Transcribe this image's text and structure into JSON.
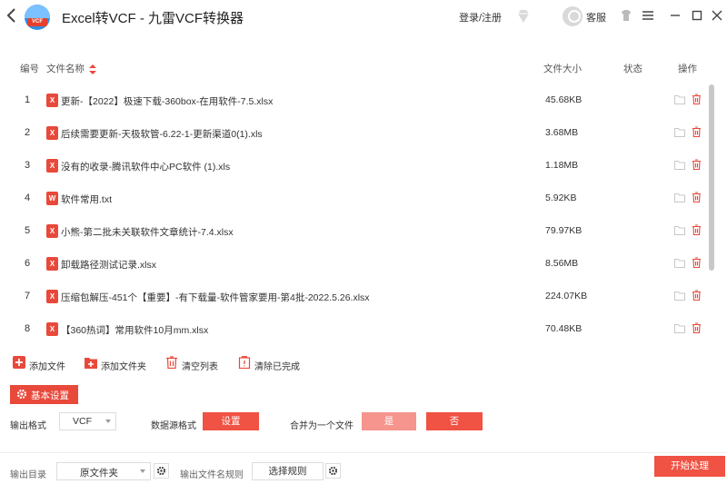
{
  "titlebar": {
    "title": "Excel转VCF - 九雷VCF转换器",
    "logo_tag": "VCF",
    "login": "登录/注册",
    "service": "客服"
  },
  "table": {
    "headers": {
      "index": "编号",
      "name": "文件名称",
      "size": "文件大小",
      "status": "状态",
      "action": "操作"
    },
    "rows": [
      {
        "index": "1",
        "type": "X",
        "name": "更新-【2022】极速下载-360box-在用软件-7.5.xlsx",
        "size": "45.68KB"
      },
      {
        "index": "2",
        "type": "X",
        "name": "后续需要更新-天极软管-6.22-1-更新渠道0(1).xls",
        "size": "3.68MB"
      },
      {
        "index": "3",
        "type": "X",
        "name": "没有的收录-腾讯软件中心PC软件 (1).xls",
        "size": "1.18MB"
      },
      {
        "index": "4",
        "type": "W",
        "name": "软件常用.txt",
        "size": "5.92KB"
      },
      {
        "index": "5",
        "type": "X",
        "name": "小熊-第二批未关联软件文章统计-7.4.xlsx",
        "size": "79.97KB"
      },
      {
        "index": "6",
        "type": "X",
        "name": "卸载路径测试记录.xlsx",
        "size": "8.56MB"
      },
      {
        "index": "7",
        "type": "X",
        "name": "压缩包解压-451个【重要】-有下载量-软件管家要用-第4批-2022.5.26.xlsx",
        "size": "224.07KB"
      },
      {
        "index": "8",
        "type": "X",
        "name": "【360热词】常用软件10月mm.xlsx",
        "size": "70.48KB"
      }
    ]
  },
  "toolbar": {
    "add_file": "添加文件",
    "add_folder": "添加文件夹",
    "clear_list": "清空列表",
    "clear_done": "清除已完成"
  },
  "settings": {
    "basic_label": "基本设置",
    "output_format_label": "输出格式",
    "output_format_value": "VCF",
    "data_source_label": "数据源格式",
    "data_source_button": "设置",
    "merge_label": "合并为一个文件",
    "merge_yes": "是",
    "merge_no": "否"
  },
  "output": {
    "dir_label": "输出目录",
    "dir_value": "原文件夹",
    "rule_label": "输出文件名规则",
    "rule_button": "选择规则",
    "start_button": "开始处理"
  },
  "colors": {
    "accent": "#f05243",
    "accent_light": "#f5958d"
  }
}
